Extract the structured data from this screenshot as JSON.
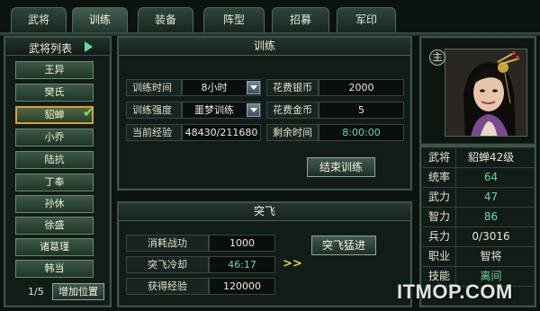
{
  "tabs": [
    {
      "label": "武将",
      "active": false
    },
    {
      "label": "训练",
      "active": true
    },
    {
      "label": "装备",
      "active": false
    },
    {
      "label": "阵型",
      "active": false
    },
    {
      "label": "招募",
      "active": false
    },
    {
      "label": "军印",
      "active": false
    }
  ],
  "general_list": {
    "title": "武将列表",
    "generals": [
      "王异",
      "樊氏",
      "貂蝉",
      "小乔",
      "陆抗",
      "丁奉",
      "孙休",
      "徐盛",
      "诸葛瑾",
      "韩当"
    ],
    "selected": "貂蝉",
    "page": "1/5",
    "add_button": "增加位置"
  },
  "training": {
    "title": "训练",
    "time_label": "训练时间",
    "time_value": "8小时",
    "intensity_label": "训练强度",
    "intensity_value": "噩梦训练",
    "exp_label": "当前经验",
    "exp_value": "48430/211680",
    "silver_label": "花费银币",
    "silver_value": "2000",
    "gold_label": "花费金币",
    "gold_value": "5",
    "remain_label": "剩余时间",
    "remain_value": "8:00:00",
    "end_button": "结束训练"
  },
  "breakthrough": {
    "title": "突飞",
    "merit_label": "消耗战功",
    "merit_value": "1000",
    "cooldown_label": "突飞冷却",
    "cooldown_value": "46:17",
    "gain_label": "获得经验",
    "gain_value": "120000",
    "button": "突飞猛进",
    "chevrons": ">>"
  },
  "portrait": {
    "badge": "主"
  },
  "stats": [
    {
      "label": "武将",
      "value": "貂蝉42级",
      "green": false
    },
    {
      "label": "统率",
      "value": "64",
      "green": true
    },
    {
      "label": "武力",
      "value": "47",
      "green": true
    },
    {
      "label": "智力",
      "value": "86",
      "green": true
    },
    {
      "label": "兵力",
      "value": "0/3016",
      "green": false
    },
    {
      "label": "职业",
      "value": "智将",
      "green": false
    },
    {
      "label": "技能",
      "value": "离间",
      "green": true
    }
  ],
  "watermark": "ITMOP.COM",
  "colors": {
    "accent_green": "#6fd79e",
    "selected_border": "#d8a428",
    "check": "#7ee05a",
    "watermark": "#ffffff"
  }
}
